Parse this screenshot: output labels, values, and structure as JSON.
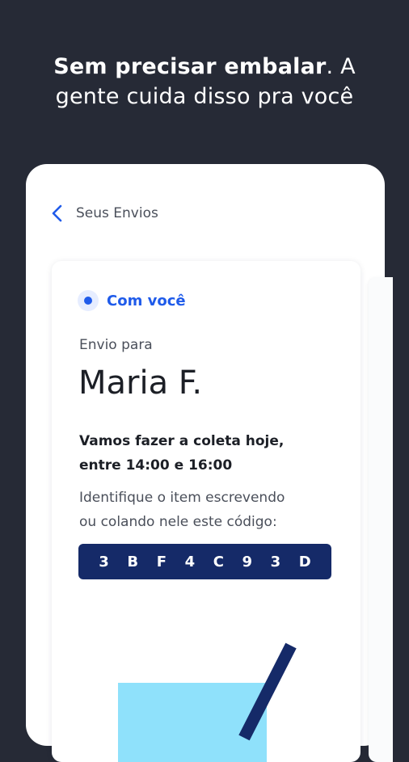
{
  "headline": {
    "bold": "Sem precisar embalar",
    "rest_line1": ". A",
    "line2": "gente cuida disso pra você"
  },
  "nav": {
    "title": "Seus Envios"
  },
  "card": {
    "status": "Com você",
    "to_label": "Envio para",
    "recipient": "Maria F.",
    "pickup_line1": "Vamos fazer a coleta hoje,",
    "pickup_line2": "entre 14:00 e 16:00",
    "instruct_line1": "Identifique o item escrevendo",
    "instruct_line2": "ou colando nele este código:",
    "code": [
      "3",
      "B",
      "F",
      "4",
      "C",
      "9",
      "3",
      "D"
    ]
  },
  "colors": {
    "background": "#262a36",
    "accent": "#1f5bea",
    "code_bg": "#152a68",
    "box": "#8fe1fb"
  }
}
